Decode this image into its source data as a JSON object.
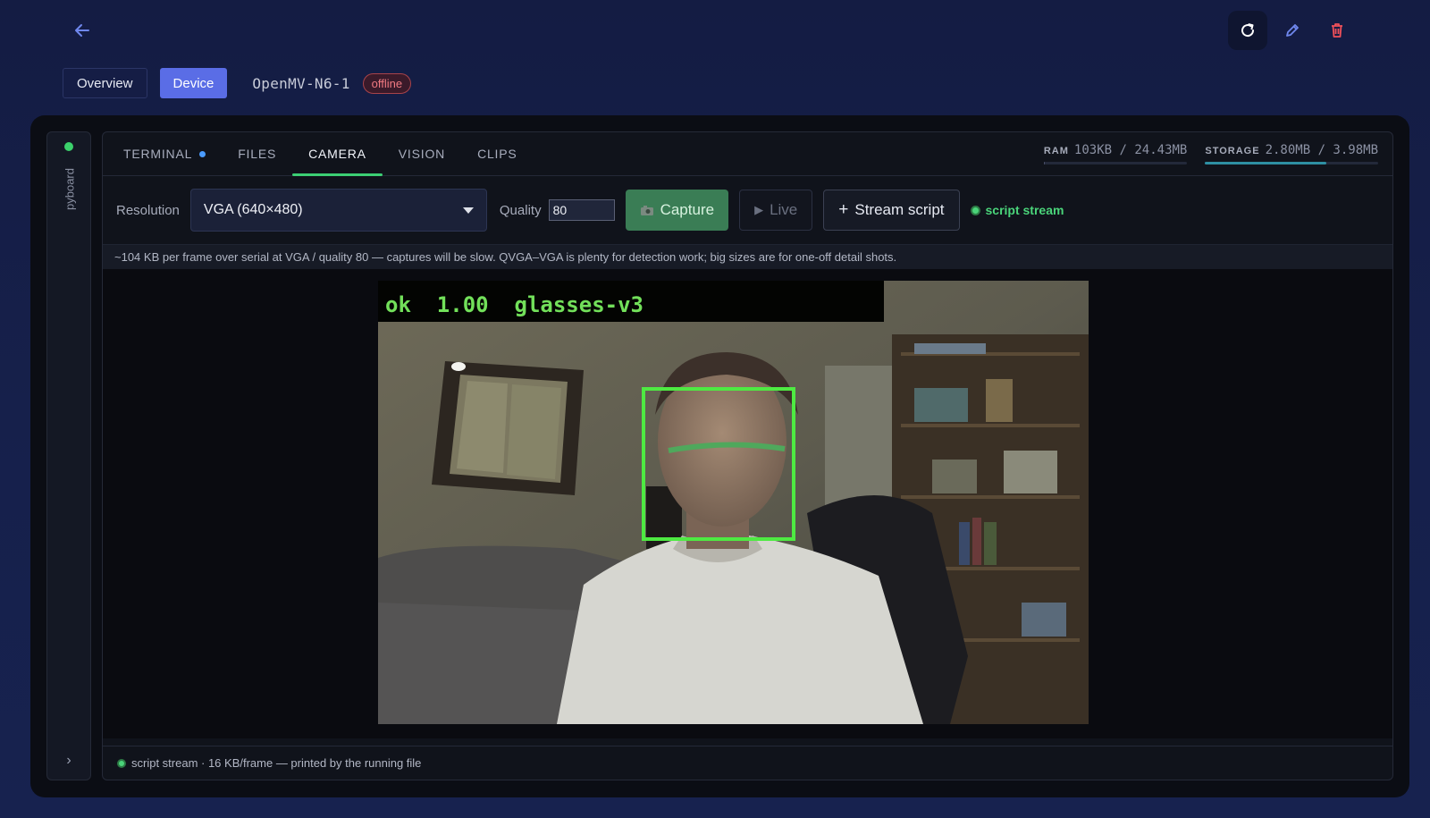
{
  "header": {
    "tabs": [
      {
        "label": "Overview",
        "active": false
      },
      {
        "label": "Device",
        "active": true
      }
    ],
    "device_name": "OpenMV-N6-1",
    "status": "offline",
    "actions": [
      "refresh-icon",
      "edit-icon",
      "trash-icon"
    ]
  },
  "rail": {
    "label": "pyboard",
    "online": true
  },
  "tabs": [
    {
      "label": "TERMINAL",
      "active": false,
      "indicator": true
    },
    {
      "label": "FILES",
      "active": false
    },
    {
      "label": "CAMERA",
      "active": true
    },
    {
      "label": "VISION",
      "active": false
    },
    {
      "label": "CLIPS",
      "active": false
    }
  ],
  "stats": {
    "ram": {
      "key": "RAM",
      "value": "103KB / 24.43MB",
      "fraction": 0.004
    },
    "storage": {
      "key": "STORAGE",
      "value": "2.80MB / 3.98MB",
      "fraction": 0.7
    }
  },
  "controls": {
    "resolution_label": "Resolution",
    "resolution_value": "VGA (640×480)",
    "quality_label": "Quality",
    "quality_value": "80",
    "capture_label": "Capture",
    "live_label": "Live",
    "stream_script_label": "Stream script",
    "stream_status": "script stream"
  },
  "hint": "~104 KB per frame over serial at VGA / quality 80 — captures will be slow. QVGA–VGA is plenty for detection work; big sizes are for one-off detail shots.",
  "frame": {
    "overlay_text": "ok  1.00  glasses-v3"
  },
  "footer": "script stream · 16 KB/frame — printed by the running file",
  "colors": {
    "accent": "#5a6de6",
    "ok_green": "#4ad47a",
    "offline_red": "#f07a82",
    "detect_box": "#4eea42"
  }
}
